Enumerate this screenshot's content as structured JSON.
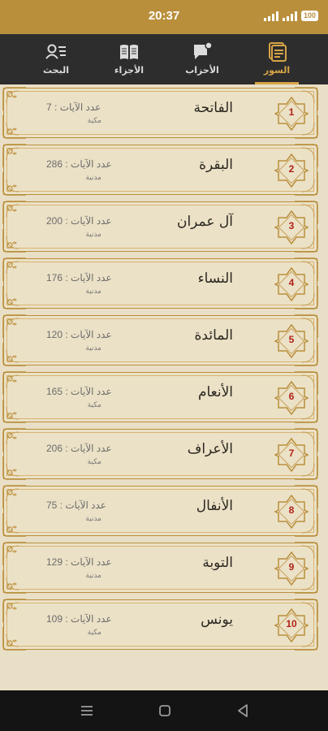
{
  "status": {
    "time": "20:37",
    "battery": "100"
  },
  "tabs": [
    {
      "label": "السور",
      "icon": "surah-list-icon",
      "active": true
    },
    {
      "label": "الأحزاب",
      "icon": "ahzab-chat-icon",
      "active": false
    },
    {
      "label": "الأجزاء",
      "icon": "open-book-icon",
      "active": false
    },
    {
      "label": "البحث",
      "icon": "search-person-icon",
      "active": false
    }
  ],
  "surahs": [
    {
      "number": "1",
      "name": "الفاتحة",
      "ayat": "عدد الآيات : 7",
      "type": "مكية"
    },
    {
      "number": "2",
      "name": "البقرة",
      "ayat": "عدد الآيات : 286",
      "type": "مدنية"
    },
    {
      "number": "3",
      "name": "آل عمران",
      "ayat": "عدد الآيات : 200",
      "type": "مدنية"
    },
    {
      "number": "4",
      "name": "النساء",
      "ayat": "عدد الآيات : 176",
      "type": "مدنية"
    },
    {
      "number": "5",
      "name": "المائدة",
      "ayat": "عدد الآيات : 120",
      "type": "مدنية"
    },
    {
      "number": "6",
      "name": "الأنعام",
      "ayat": "عدد الآيات : 165",
      "type": "مكية"
    },
    {
      "number": "7",
      "name": "الأعراف",
      "ayat": "عدد الآيات : 206",
      "type": "مكية"
    },
    {
      "number": "8",
      "name": "الأنفال",
      "ayat": "عدد الآيات : 75",
      "type": "مدنية"
    },
    {
      "number": "9",
      "name": "التوبة",
      "ayat": "عدد الآيات : 129",
      "type": "مدنية"
    },
    {
      "number": "10",
      "name": "يونس",
      "ayat": "عدد الآيات : 109",
      "type": "مكية"
    }
  ],
  "colors": {
    "accent": "#b98f3c",
    "number": "#b0221a",
    "background": "#e9dfc6"
  }
}
